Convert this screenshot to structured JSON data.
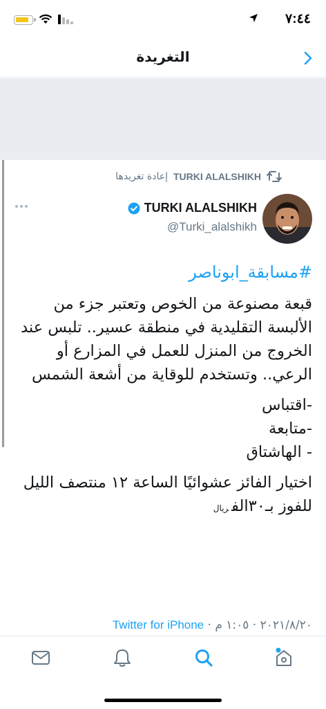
{
  "status_bar": {
    "time": "٧:٤٤"
  },
  "nav": {
    "title": "التغريدة"
  },
  "retweet": {
    "name": "TURKI ALALSHIKH",
    "label": "إعادة تغريدها"
  },
  "author": {
    "name": "TURKI ALALSHIKH",
    "handle": "@Turki_alalshikh",
    "verified": true
  },
  "tweet": {
    "hashtag": "#مسابقة_ابوناصر",
    "paragraph1": "قبعة مصنوعة من الخوص وتعتبر جزء من الألبسة التقليدية في منطقة عسير.. تلبس عند الخروج من المنزل للعمل في المزارع أو الرعي.. وتستخدم للوقاية من أشعة الشمس",
    "list": [
      "-اقتباس",
      "-متابعة",
      "- الهاشتاق"
    ],
    "paragraph2": "اختيار الفائز عشوائيًا الساعة ١٢ منتصف الليل للفوز بـ٣٠الف",
    "currency": "ريال"
  },
  "meta": {
    "date_time": "٢٠٢١/٨/٢٠ · ١:٠٥ م · ",
    "source": "Twitter for iPhone"
  },
  "tab_bar": {
    "items": [
      "home-icon",
      "search-icon",
      "notifications-icon",
      "messages-icon"
    ]
  },
  "colors": {
    "accent": "#1da1f2",
    "secondary_text": "#657786",
    "battery": "#f5c518"
  }
}
